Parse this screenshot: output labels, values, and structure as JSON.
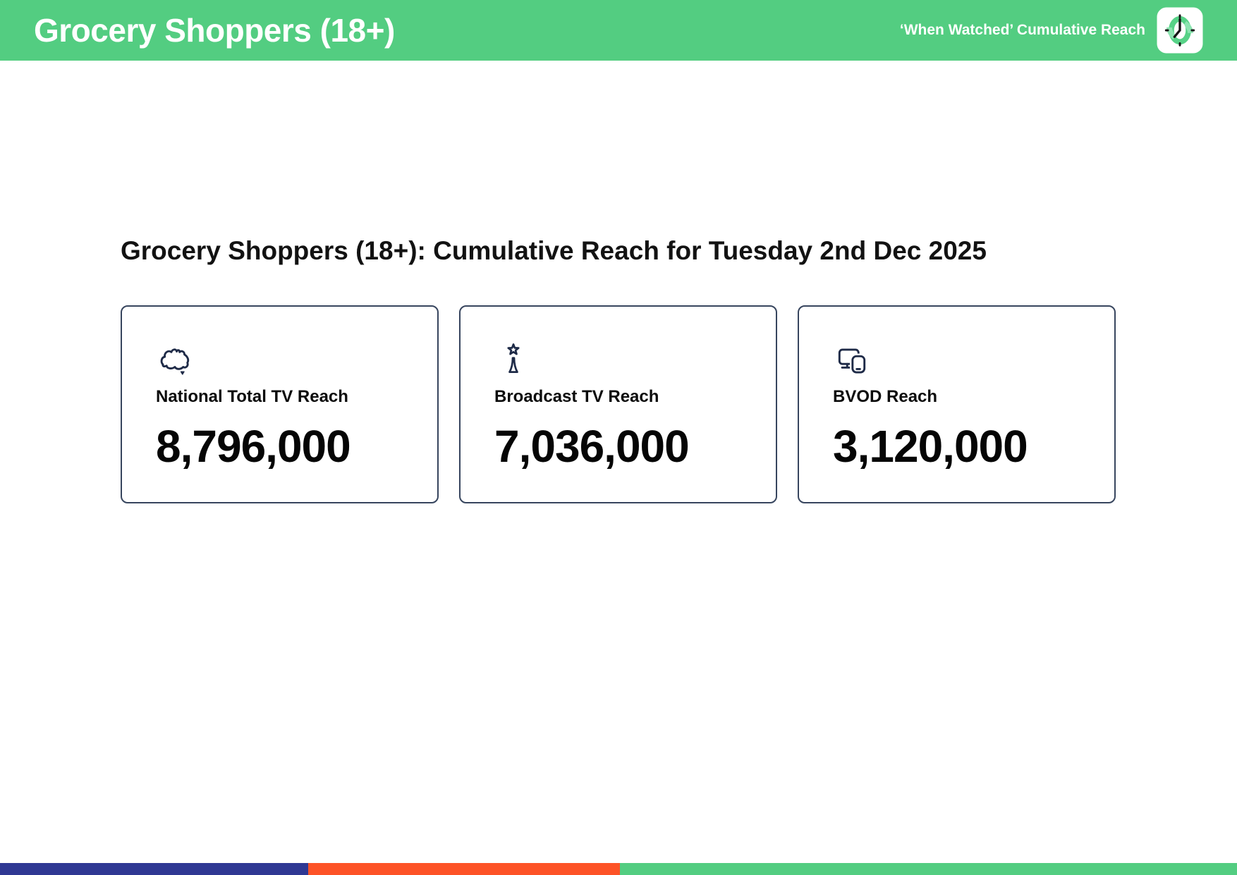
{
  "header": {
    "title": "Grocery Shoppers (18+)",
    "subtitle": "‘When Watched’ Cumulative Reach",
    "logo_icon": "clock-logo-icon"
  },
  "main": {
    "heading": "Grocery Shoppers (18+): Cumulative Reach for Tuesday 2nd Dec 2025",
    "cards": [
      {
        "icon": "australia-map-icon",
        "label": "National Total TV Reach",
        "value": "8,796,000"
      },
      {
        "icon": "broadcast-tower-icon",
        "label": "Broadcast TV Reach",
        "value": "7,036,000"
      },
      {
        "icon": "devices-icon",
        "label": "BVOD Reach",
        "value": "3,120,000"
      }
    ]
  },
  "colors": {
    "header_bg": "#53cd81",
    "icon_navy": "#1e2a47",
    "card_border": "#37455e",
    "logo_ring_green": "#57d287",
    "logo_ring_light": "#8ce4b0"
  },
  "footer": {
    "segments": [
      {
        "name": "indigo",
        "color": "#2f3893",
        "width": "24.9%"
      },
      {
        "name": "orange",
        "color": "#fd5327",
        "width": "25.2%"
      },
      {
        "name": "green",
        "color": "#53cd81",
        "width": "49.9%"
      }
    ]
  }
}
